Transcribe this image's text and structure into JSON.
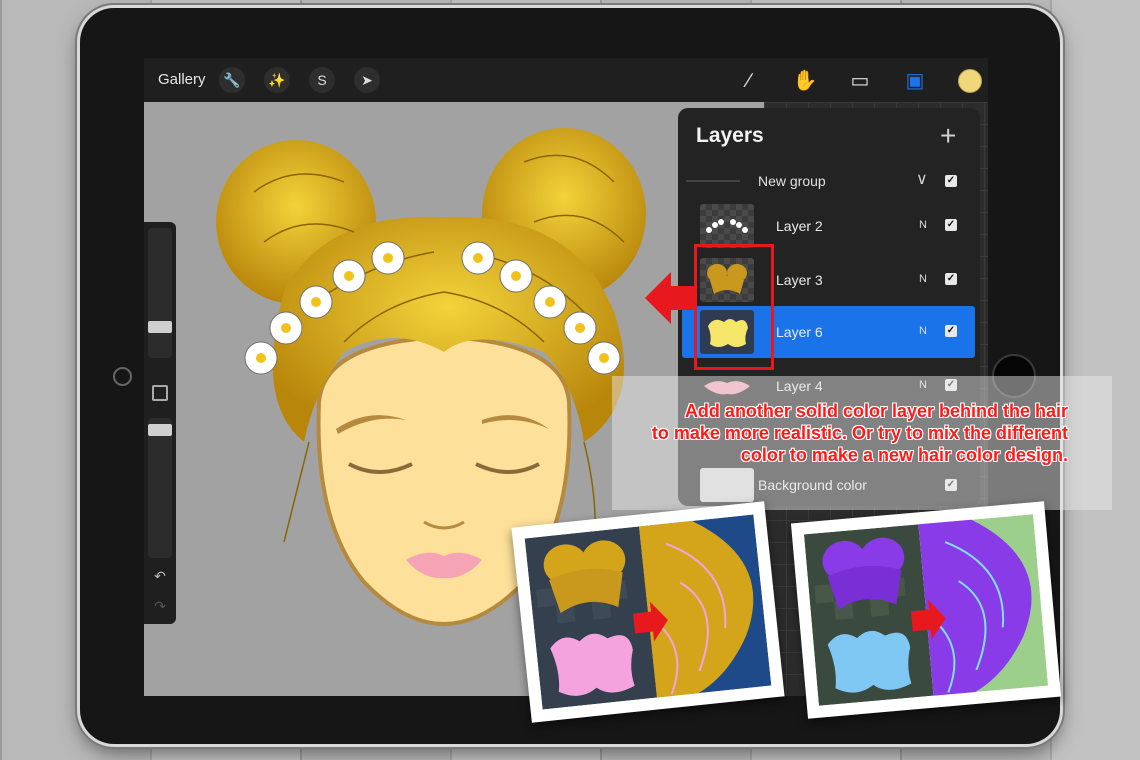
{
  "toolbar": {
    "gallery_label": "Gallery",
    "left_icons": [
      "wrench-icon",
      "magic-wand-icon",
      "selection-icon",
      "move-arrow-icon"
    ],
    "right_icons": [
      "brush-icon",
      "smudge-icon",
      "eraser-icon",
      "layers-icon",
      "color-swatch-icon"
    ],
    "current_color": "#f0d77a"
  },
  "layers_panel": {
    "title": "Layers",
    "add_symbol": "+",
    "group": {
      "label": "New group",
      "visible": true
    },
    "layers": [
      {
        "label": "Layer 2",
        "mode": "N",
        "visible": true,
        "selected": false
      },
      {
        "label": "Layer 3",
        "mode": "N",
        "visible": true,
        "selected": false
      },
      {
        "label": "Layer 6",
        "mode": "N",
        "visible": true,
        "selected": true
      },
      {
        "label": "Layer 4",
        "mode": "N",
        "visible": true,
        "selected": false
      }
    ],
    "background": {
      "label": "Background color",
      "visible": true
    }
  },
  "instruction": {
    "lines": [
      "Add another solid color layer behind the hair",
      "to make more realistic. Or try to mix the different",
      "color to make a new hair color design."
    ],
    "color": "#ff1a1a"
  },
  "colors": {
    "hair": "#d4a41a",
    "skin": "#fde09a",
    "selected_layer": "#1a73e8",
    "highlight": "#e8191e"
  }
}
